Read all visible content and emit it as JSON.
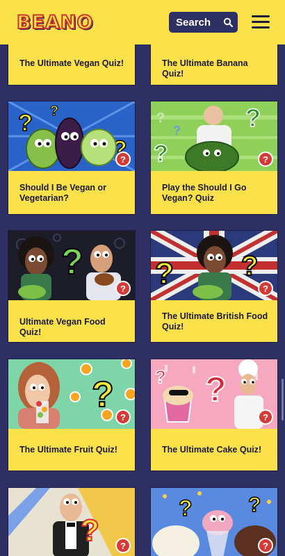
{
  "header": {
    "logo_text": "BEANO",
    "search_label": "Search"
  },
  "quizzes": [
    {
      "title": "The Ultimate Vegan Quiz!"
    },
    {
      "title": "The Ultimate Banana Quiz!"
    },
    {
      "title": "Should I Be Vegan or Vegetarian?"
    },
    {
      "title": "Play the Should I Go Vegan? Quiz"
    },
    {
      "title": "Ultimate Vegan Food Quiz!"
    },
    {
      "title": "The Ultimate British Food Quiz!"
    },
    {
      "title": "The Ultimate Fruit Quiz!"
    },
    {
      "title": "The Ultimate Cake Quiz!"
    },
    {
      "title": ""
    },
    {
      "title": ""
    }
  ],
  "colors": {
    "background": "#2e2f63",
    "accent_yellow": "#fde14a",
    "badge_red": "#d53a37"
  },
  "icons": {
    "search": "search-icon",
    "menu": "hamburger-menu-icon",
    "badge": "question-mark-icon"
  }
}
